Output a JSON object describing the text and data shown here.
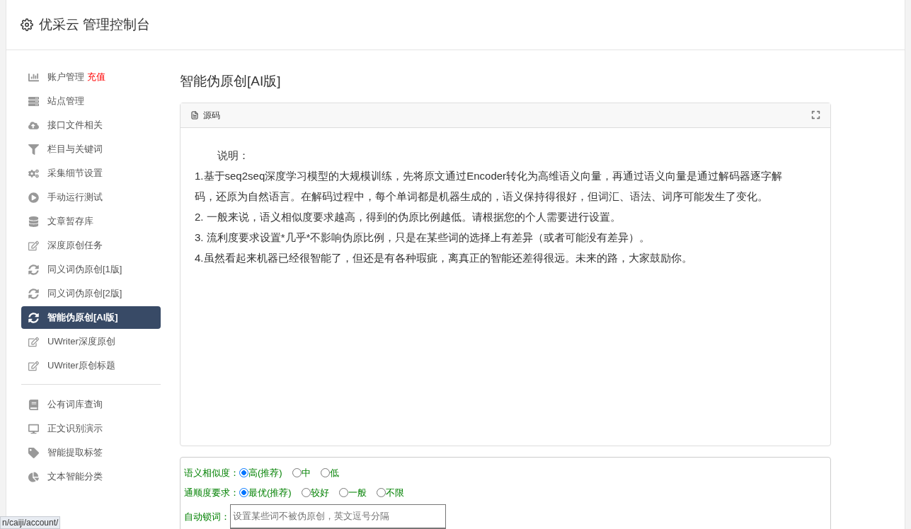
{
  "header": {
    "title": "优采云 管理控制台"
  },
  "sidebar": {
    "groups": [
      {
        "items": [
          {
            "label": "账户管理",
            "badge": "充值",
            "selected": false
          },
          {
            "label": "站点管理",
            "selected": false
          },
          {
            "label": "接口文件相关",
            "selected": false
          },
          {
            "label": "栏目与关键词",
            "selected": false
          },
          {
            "label": "采集细节设置",
            "selected": false
          },
          {
            "label": "手动运行测试",
            "selected": false
          },
          {
            "label": "文章暂存库",
            "selected": false
          },
          {
            "label": "深度原创任务",
            "selected": false
          },
          {
            "label": "同义词伪原创[1版]",
            "selected": false
          },
          {
            "label": "同义词伪原创[2版]",
            "selected": false
          },
          {
            "label": "智能伪原创[AI版]",
            "selected": true
          },
          {
            "label": "UWriter深度原创",
            "selected": false
          },
          {
            "label": "UWriter原创标题",
            "selected": false
          }
        ]
      },
      {
        "items": [
          {
            "label": "公有词库查询",
            "selected": false
          },
          {
            "label": "正文识别演示",
            "selected": false
          },
          {
            "label": "智能提取标签",
            "selected": false
          },
          {
            "label": "文本智能分类",
            "selected": false
          }
        ]
      }
    ]
  },
  "main": {
    "title": "智能伪原创[AI版]",
    "editor": {
      "source_button": "源码",
      "paragraphs": [
        {
          "kind": "heading",
          "text": "说明："
        },
        {
          "kind": "body",
          "text": "1.基于seq2seq深度学习模型的大规模训练，先将原文通过Encoder转化为高维语义向量，再通过语义向量是通过解码器逐字解码，还原为自然语言。在解码过程中，每个单词都是机器生成的，语义保持得很好，但词汇、语法、词序可能发生了变化。"
        },
        {
          "kind": "body",
          "text": "2. 一般来说，语义相似度要求越高，得到的伪原比例越低。请根据您的个人需要进行设置。"
        },
        {
          "kind": "body",
          "text": "3. 流利度要求设置*几乎*不影响伪原比例，只是在某些词的选择上有差异（或者可能没有差异）。"
        },
        {
          "kind": "body",
          "text": "4.虽然看起来机器已经很智能了，但还是有各种瑕疵，离真正的智能还差得很远。未来的路，大家鼓励你。"
        }
      ]
    },
    "options": [
      {
        "label": "语义相似度：",
        "choices": [
          {
            "label": "高(推荐)",
            "selected": true
          },
          {
            "label": "中",
            "selected": false
          },
          {
            "label": "低",
            "selected": false
          }
        ]
      },
      {
        "label": "通顺度要求：",
        "choices": [
          {
            "label": "最优(推荐)",
            "selected": true
          },
          {
            "label": "较好",
            "selected": false
          },
          {
            "label": "一般",
            "selected": false
          },
          {
            "label": "不限",
            "selected": false
          }
        ]
      }
    ],
    "lock_words": {
      "label": "自动锁词：",
      "placeholder": "设置某些词不被伪原创，英文逗号分隔"
    }
  },
  "status_url": "n/caiji/account/"
}
